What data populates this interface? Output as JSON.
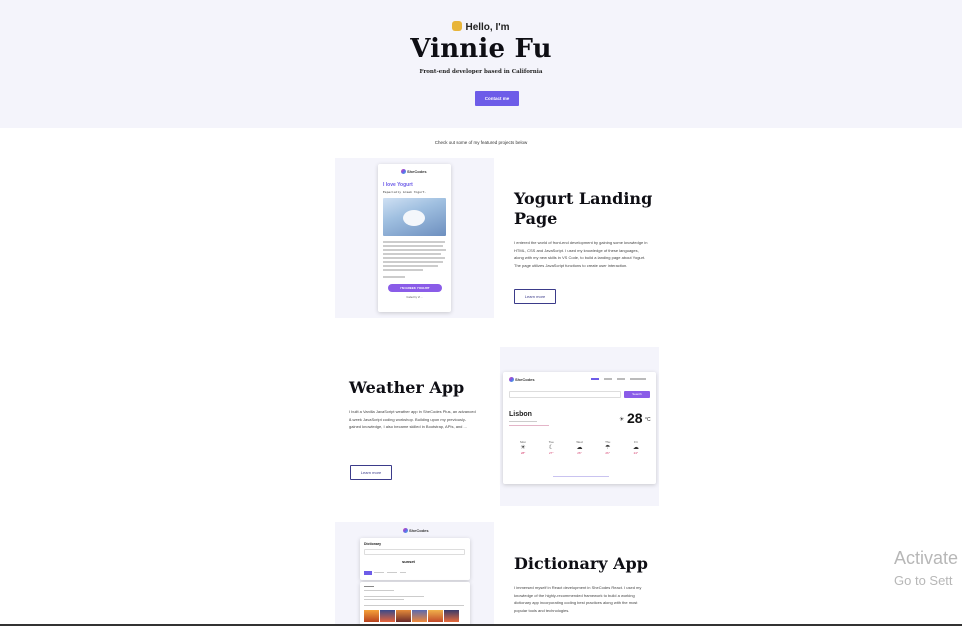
{
  "hero": {
    "greeting": "Hello, I'm",
    "name": "Vinnie Fu",
    "tagline": "Front-end developer based in California",
    "contact_label": "Contact me"
  },
  "intro": "Check out some of my featured projects below",
  "projects": [
    {
      "title": "Yogurt Landing Page",
      "description": "I entered the world of front-end development by gaining some knowledge in HTML, CSS and JavaScript. I used my knowledge of these languages, along with my new skills in VS Code, to build a landing page about Yogurt. The page utilizes JavaScript functions to create user interaction.",
      "button": "Learn more",
      "preview": {
        "brand": "SheCodes",
        "heading": "I love Yogurt",
        "subheading": "Especially Greek Yogurt.",
        "cta": "I'M GREEK YOGURT",
        "footer": "Coded by Vi ..."
      }
    },
    {
      "title": "Weather App",
      "description": "I built a Vanilla JavaScript weather app in SheCodes Plus, an advanced 8-week JavaScript coding workshop. Building upon my previously-gained knowledge, I also became skilled in Bootstrap, APIs, and ...",
      "button": "Learn more",
      "preview": {
        "brand": "SheCodes",
        "search_button": "Search",
        "city": "Lisbon",
        "temperature": "28",
        "unit": "°C",
        "days": [
          "Mon",
          "Tue",
          "Wed",
          "Thu",
          "Fri"
        ],
        "highs": [
          "28°",
          "27°",
          "26°",
          "26°",
          "24°"
        ]
      }
    },
    {
      "title": "Dictionary App",
      "description": "I immersed myself in React development in SheCodes React. I used my knowledge of the highly-recommended framework to build a working dictionary app incorporating coding best practices along with the most popular tools and technologies.",
      "button": "Learn more",
      "preview": {
        "brand": "SheCodes",
        "heading": "Dictionary",
        "word": "sunset"
      }
    }
  ],
  "watermark": {
    "line1": "Activate",
    "line2": "Go to Sett"
  }
}
